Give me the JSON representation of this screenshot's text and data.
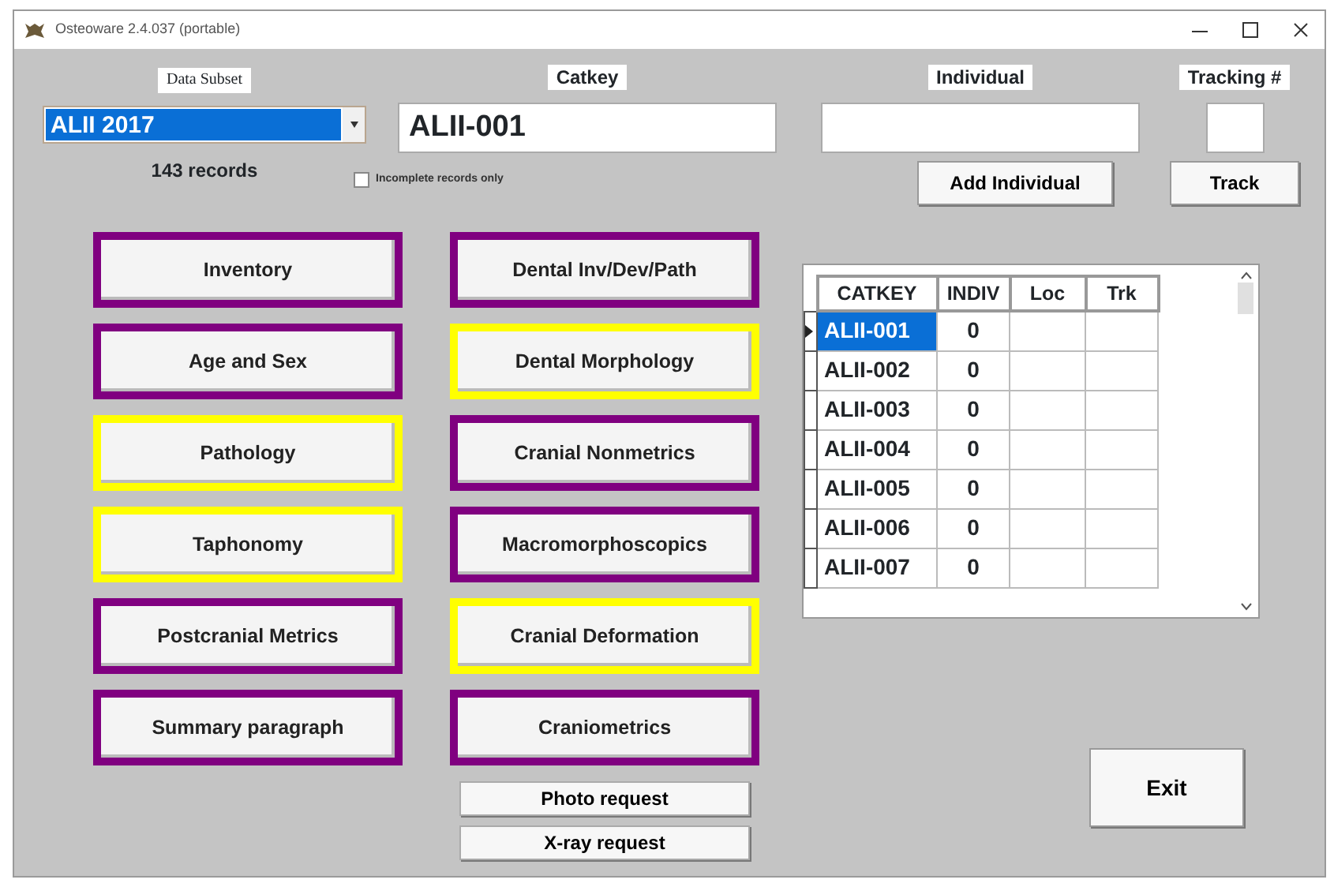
{
  "window": {
    "title": "Osteoware 2.4.037 (portable)"
  },
  "data_subset": {
    "label": "Data Subset",
    "value": "ALII 2017",
    "records": "143 records"
  },
  "catkey": {
    "label": "Catkey",
    "value": "ALII-001"
  },
  "incomplete_only": {
    "label": "Incomplete records only",
    "checked": false
  },
  "individual": {
    "label": "Individual",
    "button": "Add Individual"
  },
  "tracking": {
    "label": "Tracking #",
    "button": "Track"
  },
  "modules_left": [
    {
      "label": "Inventory",
      "kind": "module",
      "color": "#800080"
    },
    {
      "label": "Age and Sex",
      "kind": "module",
      "color": "#800080"
    },
    {
      "label": "Pathology",
      "kind": "module",
      "color": "#ffff00"
    },
    {
      "label": "Taphonomy",
      "kind": "module",
      "color": "#ffff00"
    },
    {
      "label": "Postcranial Metrics",
      "kind": "module",
      "color": "#800080"
    },
    {
      "label": "Summary paragraph",
      "kind": "module",
      "color": "#800080"
    }
  ],
  "modules_right": [
    {
      "label": "Dental Inv/Dev/Path",
      "kind": "module",
      "color": "#800080"
    },
    {
      "label": "Dental Morphology",
      "kind": "module",
      "color": "#ffff00"
    },
    {
      "label": "Cranial Nonmetrics",
      "kind": "module",
      "color": "#800080"
    },
    {
      "label": "Macromorphoscopics",
      "kind": "module",
      "color": "#800080"
    },
    {
      "label": "Cranial Deformation",
      "kind": "module",
      "color": "#ffff00"
    },
    {
      "label": "Craniometrics",
      "kind": "module",
      "color": "#800080"
    },
    {
      "label": "Photo request",
      "kind": "plain"
    },
    {
      "label": "X-ray request",
      "kind": "plain"
    }
  ],
  "grid": {
    "columns": [
      "CATKEY",
      "INDIV",
      "Loc",
      "Trk"
    ],
    "rows": [
      {
        "catkey": "ALII-001",
        "indiv": "0",
        "selected": true
      },
      {
        "catkey": "ALII-002",
        "indiv": "0",
        "selected": false
      },
      {
        "catkey": "ALII-003",
        "indiv": "0",
        "selected": false
      },
      {
        "catkey": "ALII-004",
        "indiv": "0",
        "selected": false
      },
      {
        "catkey": "ALII-005",
        "indiv": "0",
        "selected": false
      },
      {
        "catkey": "ALII-006",
        "indiv": "0",
        "selected": false
      },
      {
        "catkey": "ALII-007",
        "indiv": "0",
        "selected": false
      }
    ]
  },
  "exit_button": "Exit"
}
